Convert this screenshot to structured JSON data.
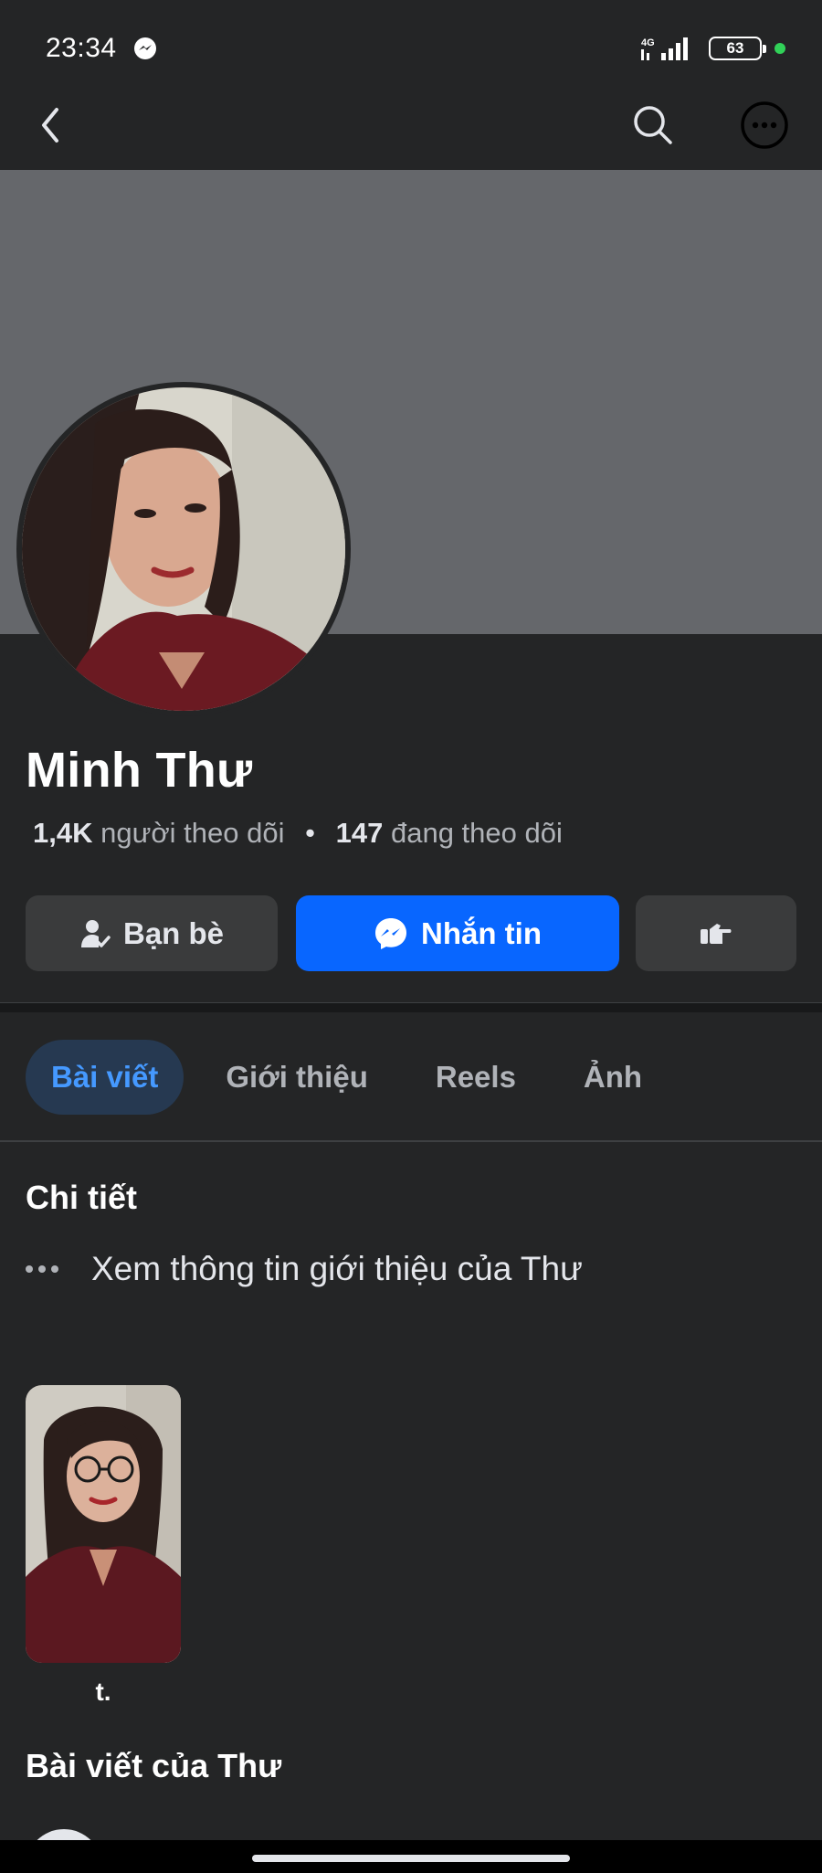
{
  "status_bar": {
    "time": "23:34",
    "network": "4G",
    "battery": "63"
  },
  "nav": {
    "back_icon": "chevron-left-icon",
    "search_icon": "search-icon",
    "more_icon": "more-circle-icon"
  },
  "profile": {
    "name": "Minh Thư",
    "followers_count": "1,4K",
    "followers_label": "người theo dõi",
    "separator": "•",
    "following_count": "147",
    "following_label": "đang theo dõi"
  },
  "actions": {
    "friends_label": "Bạn bè",
    "message_label": "Nhắn tin"
  },
  "tabs": [
    {
      "label": "Bài viết",
      "active": true
    },
    {
      "label": "Giới thiệu",
      "active": false
    },
    {
      "label": "Reels",
      "active": false
    },
    {
      "label": "Ảnh",
      "active": false
    }
  ],
  "details": {
    "title": "Chi tiết",
    "about_link": "Xem thông tin giới thiệu của Thư"
  },
  "featured": {
    "label": "t."
  },
  "posts": {
    "title": "Bài viết của Thư"
  },
  "colors": {
    "background": "#242526",
    "cover": "#65676b",
    "accent": "#0866ff",
    "active_tab_bg": "#263951",
    "active_tab_text": "#4599ff"
  }
}
